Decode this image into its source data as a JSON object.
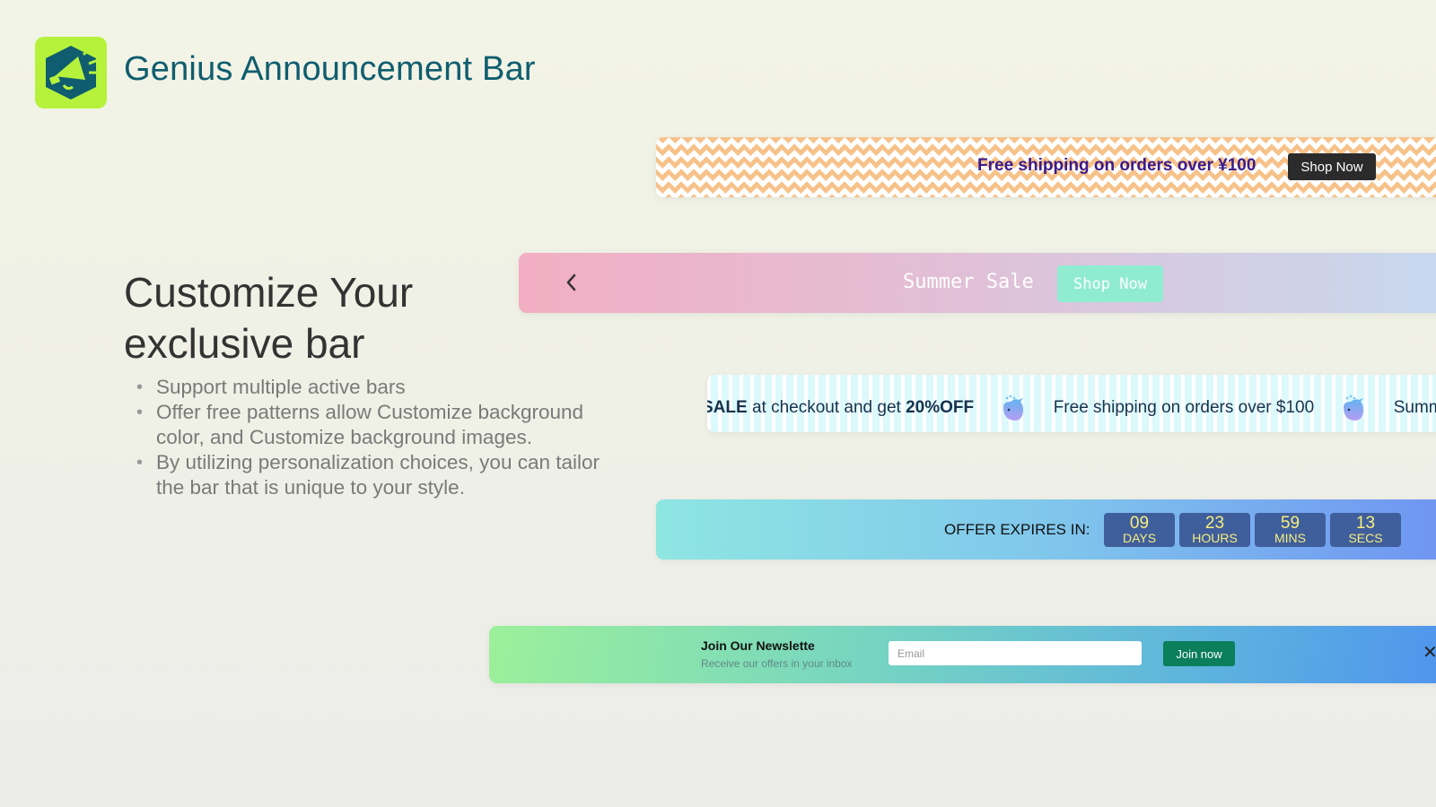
{
  "app": {
    "title": "Genius Announcement Bar",
    "logo_icon": "megaphone-icon",
    "logo_bg": "#b6f23c",
    "logo_fg": "#0f5d6e"
  },
  "hero": {
    "title": "Customize Your exclusive bar",
    "features": [
      "Support multiple active bars",
      "Offer free patterns allow Customize background color, and Customize background images.",
      "By utilizing personalization choices, you can tailor the bar that is unique to your style."
    ]
  },
  "bars": {
    "shipping": {
      "text": "Free shipping on orders over ¥100",
      "button": "Shop Now",
      "pattern": "chevron",
      "pattern_color": "#f7c28a",
      "text_color": "#3b1a8a"
    },
    "summer": {
      "prev_icon": "chevron-left-icon",
      "text": "Summer Sale",
      "button": "Shop Now",
      "button_color": "#8fecd1"
    },
    "marquee": {
      "segment1_bold_prefix": "SALE",
      "segment1_text": " at checkout and get ",
      "segment1_bold_suffix": "20%OFF",
      "separator_icon": "whale-icon",
      "segment2_text": "Free shipping on orders over $100",
      "segment3_text": "Summ"
    },
    "countdown": {
      "label": "OFFER EXPIRES IN:",
      "units": [
        {
          "value": "09",
          "label": "DAYS"
        },
        {
          "value": "23",
          "label": "HOURS"
        },
        {
          "value": "59",
          "label": "MINS"
        },
        {
          "value": "13",
          "label": "SECS"
        }
      ],
      "box_color": "#3f5e9c",
      "digit_color": "#f7ee7e"
    },
    "newsletter": {
      "title": "Join Our Newslette",
      "subtitle": "Receive our offers in your inbox",
      "email_placeholder": "Email",
      "email_value": "",
      "button": "Join now",
      "button_color": "#0b7e5a",
      "close_label": "✕"
    }
  }
}
